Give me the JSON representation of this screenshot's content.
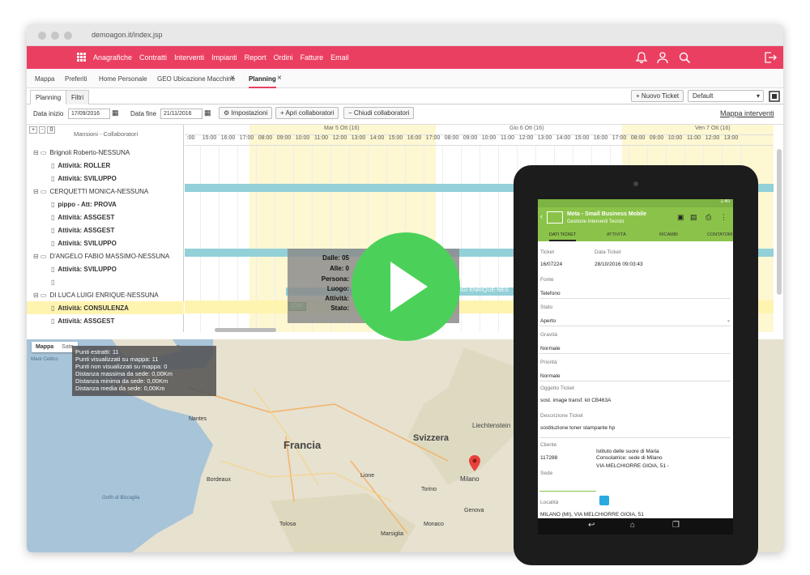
{
  "browser": {
    "url": "demoagon.it/index.jsp"
  },
  "menu": [
    "Anagrafiche",
    "Contratti",
    "Interventi",
    "Impianti",
    "Report",
    "Ordini",
    "Fatture",
    "Email"
  ],
  "tabs": [
    "Mappa",
    "Preferiti",
    "Home Personale",
    "GEO Ubicazione Macchine",
    "Planning"
  ],
  "planning": {
    "subtabs": [
      "Planning",
      "Filtri"
    ],
    "data_inizio_label": "Data inizio",
    "data_inizio": "17/09/2016",
    "data_fine_label": "Data fine",
    "data_fine": "21/11/2016",
    "impostazioni": "Impostazioni",
    "apri": "Apri collaboratori",
    "chiudi": "Chiudi collaboratori",
    "nuovo_ticket": "Nuovo Ticket",
    "default_select": "Default",
    "mappa_interventi": "Mappa interventi",
    "left_header": "Mansioni - Collaboratori",
    "ctrl": [
      "+",
      "-",
      "0"
    ],
    "days": [
      "Mar 5 Ott (16)",
      "Gio 6 Ott (16)",
      "Ven 7 Ott (16)"
    ],
    "hours": [
      ":00",
      "15:00",
      "16:00",
      "17:00",
      "08:00",
      "09:00",
      "10:00",
      "11:00",
      "12:00",
      "13:00",
      "14:00",
      "15:00",
      "16:00",
      "17:00",
      "08:00",
      "09:00",
      "10:00",
      "11:00",
      "12:00",
      "13:00",
      "14:00",
      "15:00",
      "16:00",
      "17:00",
      "08:00",
      "09:00",
      "10:00",
      "11:00",
      "12:00",
      "13:00"
    ],
    "rows": [
      {
        "label": "Brignoli Roberto-NESSUNA",
        "type": "group"
      },
      {
        "label": "Attività: ROLLER",
        "type": "item"
      },
      {
        "label": "Attività: SVILUPPO",
        "type": "item"
      },
      {
        "label": "CERQUETTI MONICA-NESSUNA",
        "type": "group"
      },
      {
        "label": "pippo - Att: PROVA",
        "type": "item"
      },
      {
        "label": "Attività: ASSGEST",
        "type": "item"
      },
      {
        "label": "Attività: ASSGEST",
        "type": "item"
      },
      {
        "label": "Attività: SVILUPPO",
        "type": "item"
      },
      {
        "label": "D'ANGELO FABIO MASSIMO-NESSUNA",
        "type": "group"
      },
      {
        "label": "Attività: SVILUPPO",
        "type": "item"
      },
      {
        "label": "",
        "type": "item"
      },
      {
        "label": "DI LUCA LUIGI ENRIQUE-NESSUNA",
        "type": "group"
      },
      {
        "label": "Attività: CONSULENZA",
        "type": "item"
      },
      {
        "label": "Attività: ASSGEST",
        "type": "item"
      }
    ],
    "band_label": "UIGI ENRIQUE-NES",
    "tooltip": [
      "Dalle: 05",
      "Alle: 0",
      "Persona:",
      "Luogo:",
      "Attività:",
      "Stato:"
    ]
  },
  "map": {
    "tabs": [
      "Mappa",
      "Sate"
    ],
    "info": [
      "Punti estratti: 11",
      "Punti visualizzati su mappa: 11",
      "Punti non visualizzati su mappa: 0",
      "Distanza massima da sede: 0,00Km",
      "Distanza minima da sede: 0,00Km",
      "Distanza media da sede: 0,00Km"
    ],
    "labels": {
      "francia": "Francia",
      "svizzera": "Svizzera",
      "milano": "Milano",
      "liechtenstein": "Liechtenstein",
      "guernsey": "Guernsey",
      "biscaglia": "Golfo di Biscaglia",
      "mare": "Mare Celtico",
      "torino": "Torino",
      "genova": "Genova",
      "nantes": "Nantes",
      "lione": "Lione",
      "bordeaux": "Bordeaux",
      "tolosa": "Tolosa",
      "marsiglia": "Marsiglia",
      "monaco": "Monaco"
    }
  },
  "tablet": {
    "app_title": "Meta - Small Business Mobile",
    "app_sub": "Gestione Interventi Tecnici",
    "tabs": [
      "DATI TICKET",
      "ATTIVITÀ",
      "RICAMBI",
      "CONTATORI"
    ],
    "ticket_label": "Ticket",
    "ticket": "16/07224",
    "data_label": "Data Ticket",
    "data": "28/10/2016 09:03:43",
    "fonte_label": "Fonte",
    "fonte": "Telefono",
    "stato_label": "Stato",
    "stato": "Aperto",
    "gravita_label": "Gravità",
    "gravita": "Normale",
    "priorita_label": "Priorità",
    "priorita": "Normale",
    "oggetto_label": "Oggetto Ticket",
    "oggetto": "sost. image transf. kit CB463A",
    "descr_label": "Descrizione Ticket",
    "descr": "sostituzione toner stampante hp",
    "cliente_label": "Cliente",
    "cliente": "117288",
    "cliente_name": "Istituto delle suore di Maria Consolatrice: sede di Milano",
    "cliente_addr": "VIA MELCHIORRE GIOIA, 51 -",
    "sede_label": "Sede",
    "localita_label": "Località",
    "localita": "MILANO (MI), VIA MELCHIORRE GIOIA, 51",
    "status_time": "1:40"
  },
  "colors": {
    "brand": "#ea3f61",
    "green": "#8bc34a",
    "play": "#4bd15a"
  }
}
